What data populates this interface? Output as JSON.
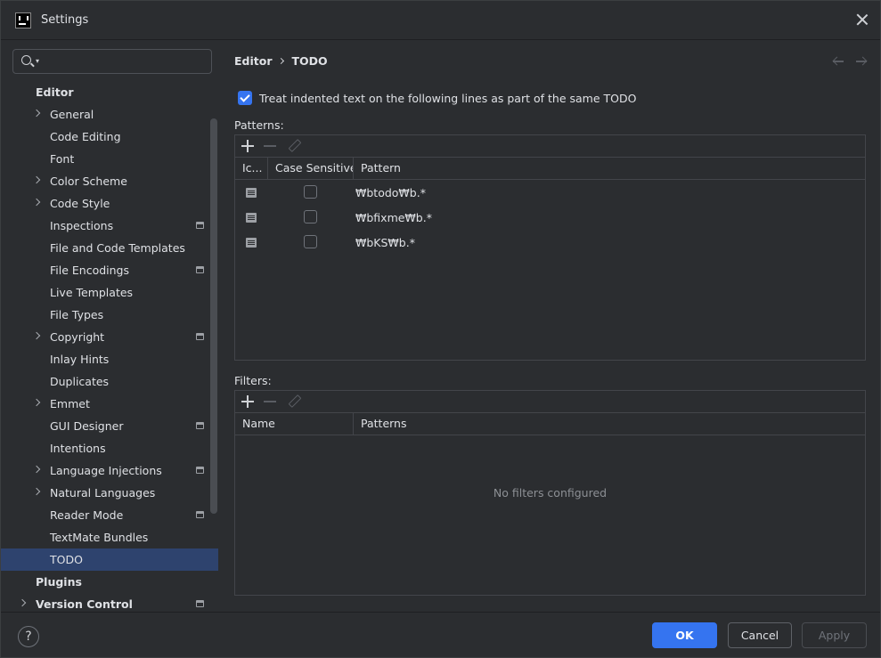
{
  "window": {
    "title": "Settings"
  },
  "sidebar": {
    "search": {
      "placeholder": ""
    },
    "items": [
      {
        "label": "Editor",
        "group": true,
        "indent": 0,
        "expandable": false,
        "project_icon": false
      },
      {
        "label": "General",
        "indent": 1,
        "expandable": true,
        "project_icon": false
      },
      {
        "label": "Code Editing",
        "indent": 1,
        "expandable": false,
        "project_icon": false
      },
      {
        "label": "Font",
        "indent": 1,
        "expandable": false,
        "project_icon": false
      },
      {
        "label": "Color Scheme",
        "indent": 1,
        "expandable": true,
        "project_icon": false
      },
      {
        "label": "Code Style",
        "indent": 1,
        "expandable": true,
        "project_icon": false
      },
      {
        "label": "Inspections",
        "indent": 1,
        "expandable": false,
        "project_icon": true
      },
      {
        "label": "File and Code Templates",
        "indent": 1,
        "expandable": false,
        "project_icon": false
      },
      {
        "label": "File Encodings",
        "indent": 1,
        "expandable": false,
        "project_icon": true
      },
      {
        "label": "Live Templates",
        "indent": 1,
        "expandable": false,
        "project_icon": false
      },
      {
        "label": "File Types",
        "indent": 1,
        "expandable": false,
        "project_icon": false
      },
      {
        "label": "Copyright",
        "indent": 1,
        "expandable": true,
        "project_icon": true
      },
      {
        "label": "Inlay Hints",
        "indent": 1,
        "expandable": false,
        "project_icon": false
      },
      {
        "label": "Duplicates",
        "indent": 1,
        "expandable": false,
        "project_icon": false
      },
      {
        "label": "Emmet",
        "indent": 1,
        "expandable": true,
        "project_icon": false
      },
      {
        "label": "GUI Designer",
        "indent": 1,
        "expandable": false,
        "project_icon": true
      },
      {
        "label": "Intentions",
        "indent": 1,
        "expandable": false,
        "project_icon": false
      },
      {
        "label": "Language Injections",
        "indent": 1,
        "expandable": true,
        "project_icon": true
      },
      {
        "label": "Natural Languages",
        "indent": 1,
        "expandable": true,
        "project_icon": false
      },
      {
        "label": "Reader Mode",
        "indent": 1,
        "expandable": false,
        "project_icon": true
      },
      {
        "label": "TextMate Bundles",
        "indent": 1,
        "expandable": false,
        "project_icon": false
      },
      {
        "label": "TODO",
        "indent": 1,
        "expandable": false,
        "project_icon": false,
        "selected": true
      },
      {
        "label": "Plugins",
        "group": true,
        "indent": 0,
        "expandable": false,
        "project_icon": false
      },
      {
        "label": "Version Control",
        "group": true,
        "indent": 0,
        "expandable": true,
        "project_icon": true
      }
    ]
  },
  "breadcrumb": {
    "parent": "Editor",
    "current": "TODO"
  },
  "options": {
    "treat_indented_label": "Treat indented text on the following lines as part of the same TODO",
    "treat_indented_checked": true
  },
  "patterns": {
    "label": "Patterns:",
    "columns": {
      "icon": "Ic...",
      "case": "Case Sensitive",
      "pattern": "Pattern"
    },
    "rows": [
      {
        "pattern": "₩btodo₩b.*",
        "case_sensitive": false
      },
      {
        "pattern": "₩bfixme₩b.*",
        "case_sensitive": false
      },
      {
        "pattern": "₩bKS₩b.*",
        "case_sensitive": false
      }
    ]
  },
  "filters": {
    "label": "Filters:",
    "columns": {
      "name": "Name",
      "patterns": "Patterns"
    },
    "empty_text": "No filters configured"
  },
  "footer": {
    "help": "?",
    "ok": "OK",
    "cancel": "Cancel",
    "apply": "Apply"
  },
  "colors": {
    "accent": "#3574f0",
    "selection": "#2e436e",
    "background": "#2b2d30"
  }
}
